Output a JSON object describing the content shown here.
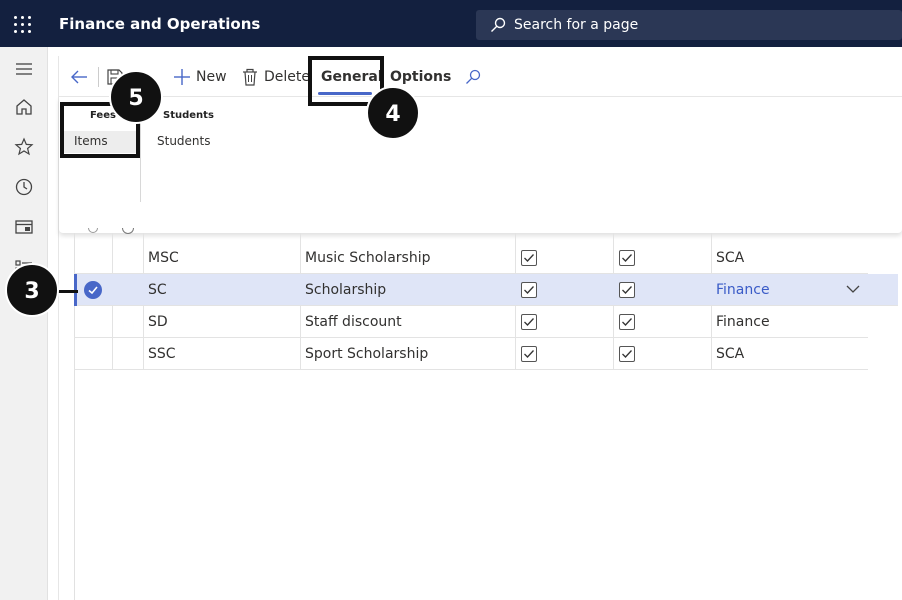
{
  "header": {
    "app_title": "Finance and Operations",
    "search_placeholder": "Search for a page"
  },
  "left_nav": {
    "items": [
      "hamburger-icon",
      "home-icon",
      "star-icon",
      "clock-icon",
      "workspace-icon",
      "modules-icon"
    ]
  },
  "action_pane": {
    "back_icon": "back-arrow-icon",
    "save_icon": "save-icon",
    "new_label": "New",
    "delete_label": "Delete",
    "tab_general": "General",
    "tab_options": "Options",
    "search_icon": "search-icon",
    "active_tab": "General"
  },
  "ribbon": {
    "groups": [
      {
        "title": "Fees",
        "items": [
          "Items"
        ]
      },
      {
        "title": "Students",
        "items": [
          "Students"
        ]
      }
    ]
  },
  "grid": {
    "rows": [
      {
        "code": "MSC",
        "name": "Music Scholarship",
        "check1": true,
        "check2": true,
        "type": "SCA",
        "selected": false
      },
      {
        "code": "SC",
        "name": "Scholarship",
        "check1": true,
        "check2": true,
        "type": "Finance",
        "selected": true
      },
      {
        "code": "SD",
        "name": "Staff discount",
        "check1": true,
        "check2": true,
        "type": "Finance",
        "selected": false
      },
      {
        "code": "SSC",
        "name": "Sport Scholarship",
        "check1": true,
        "check2": true,
        "type": "SCA",
        "selected": false
      }
    ]
  },
  "callouts": {
    "c3": "3",
    "c4": "4",
    "c5": "5"
  },
  "colors": {
    "topbar": "#13203f",
    "accent": "#4867c8",
    "selected_row": "#dfe5f7"
  }
}
